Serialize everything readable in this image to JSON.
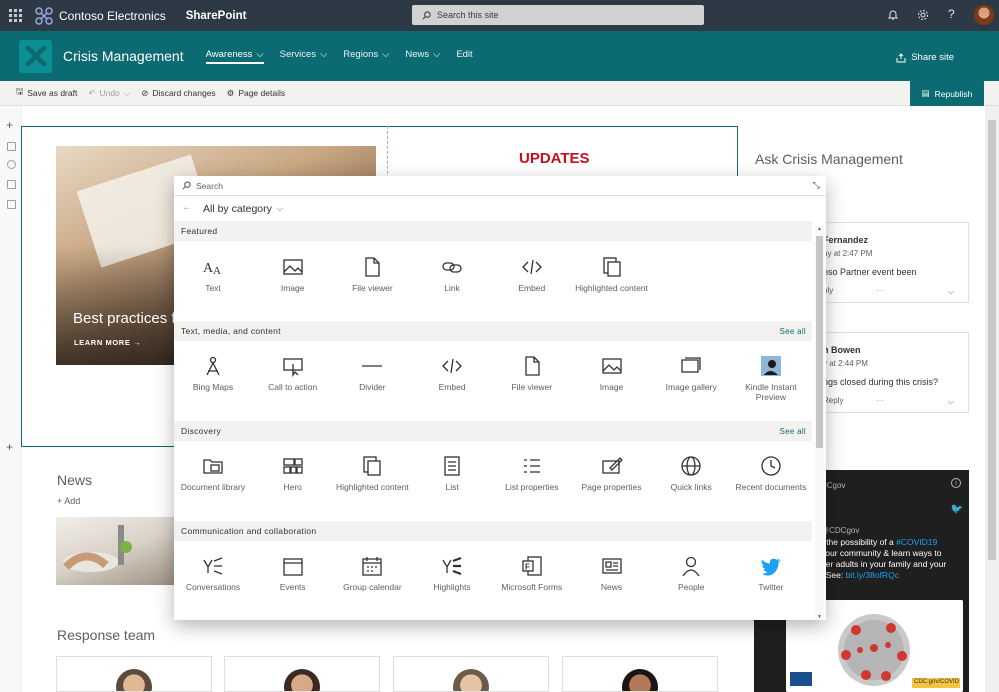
{
  "topbar": {
    "org_name": "Contoso Electronics",
    "app_name": "SharePoint",
    "search_placeholder": "Search this site"
  },
  "site": {
    "title": "Crisis Management",
    "nav": [
      {
        "label": "Awareness",
        "dropdown": true,
        "active": true
      },
      {
        "label": "Services",
        "dropdown": true,
        "active": false
      },
      {
        "label": "Regions",
        "dropdown": true,
        "active": false
      },
      {
        "label": "News",
        "dropdown": true,
        "active": false
      },
      {
        "label": "Edit",
        "dropdown": false,
        "active": false
      }
    ],
    "share_label": "Share site"
  },
  "commandbar": {
    "save_draft": "Save as draft",
    "undo": "Undo",
    "discard": "Discard changes",
    "page_details": "Page details",
    "republish": "Republish"
  },
  "page": {
    "hero_title": "Best practices fo",
    "hero_link": "LEARN MORE →",
    "updates_title": "UPDATES",
    "ask_title": "Ask Crisis Management",
    "news_title": "News",
    "news_add": "+ Add",
    "response_title": "Response team",
    "comments": [
      {
        "name": "Fernandez",
        "time": "ay at 2:47 PM",
        "text": "oso Partner event been",
        "reply": "ply"
      },
      {
        "name": "n Bowen",
        "time": "y at 2:44 PM",
        "text": "ngs closed during this crisis?",
        "reply": "Reply"
      }
    ],
    "tweet": {
      "handle": "DCgov",
      "handle2": "@CDCgov",
      "line1_a": "r the possibility of a ",
      "line1_hashtag": "#COVID19",
      "line2": "your community & learn ways to",
      "line3": "der adults in your family and your",
      "line4_a": ". See: ",
      "line4_link": "bit.ly/38ofRQc",
      "image_caption": "CDC.gov/COVID"
    }
  },
  "picker": {
    "search_placeholder": "Search",
    "category_label": "All by category",
    "sections": [
      {
        "title": "Featured",
        "see_all": "",
        "tiles": [
          {
            "label": "Text",
            "icon": "text-icon"
          },
          {
            "label": "Image",
            "icon": "image-icon"
          },
          {
            "label": "File viewer",
            "icon": "file-viewer-icon"
          },
          {
            "label": "Link",
            "icon": "link-icon"
          },
          {
            "label": "Embed",
            "icon": "embed-icon"
          },
          {
            "label": "Highlighted content",
            "icon": "highlighted-content-icon"
          }
        ]
      },
      {
        "title": "Text, media, and content",
        "see_all": "See all",
        "tiles": [
          {
            "label": "Bing Maps",
            "icon": "bing-maps-icon"
          },
          {
            "label": "Call to action",
            "icon": "call-to-action-icon"
          },
          {
            "label": "Divider",
            "icon": "divider-icon"
          },
          {
            "label": "Embed",
            "icon": "embed-icon"
          },
          {
            "label": "File viewer",
            "icon": "file-viewer-icon"
          },
          {
            "label": "Image",
            "icon": "image-icon"
          },
          {
            "label": "Image gallery",
            "icon": "image-gallery-icon"
          },
          {
            "label": "Kindle Instant Preview",
            "icon": "kindle-icon"
          }
        ]
      },
      {
        "title": "Discovery",
        "see_all": "See all",
        "tiles": [
          {
            "label": "Document library",
            "icon": "document-library-icon"
          },
          {
            "label": "Hero",
            "icon": "hero-icon"
          },
          {
            "label": "Highlighted content",
            "icon": "highlighted-content-icon"
          },
          {
            "label": "List",
            "icon": "list-icon"
          },
          {
            "label": "List properties",
            "icon": "list-properties-icon"
          },
          {
            "label": "Page properties",
            "icon": "page-properties-icon"
          },
          {
            "label": "Quick links",
            "icon": "globe-icon"
          },
          {
            "label": "Recent documents",
            "icon": "clock-icon"
          }
        ]
      },
      {
        "title": "Communication and collaboration",
        "see_all": "",
        "tiles": [
          {
            "label": "Conversations",
            "icon": "yammer-icon"
          },
          {
            "label": "Events",
            "icon": "calendar-icon"
          },
          {
            "label": "Group calendar",
            "icon": "group-calendar-icon"
          },
          {
            "label": "Highlights",
            "icon": "highlights-icon"
          },
          {
            "label": "Microsoft Forms",
            "icon": "forms-icon"
          },
          {
            "label": "News",
            "icon": "news-icon"
          },
          {
            "label": "People",
            "icon": "people-icon"
          },
          {
            "label": "Twitter",
            "icon": "twitter-icon"
          }
        ]
      }
    ]
  },
  "colors": {
    "suite_bar": "#2d3945",
    "theme": "#0b6a72",
    "updates_red": "#c50f1f",
    "twitter_blue": "#1da1f2"
  }
}
